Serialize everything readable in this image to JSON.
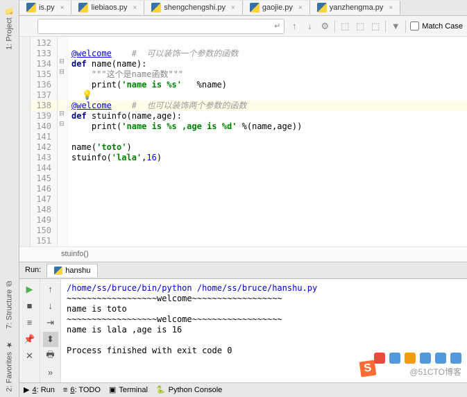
{
  "sidebar": {
    "top": [
      {
        "label": "1: Project",
        "name": "project"
      }
    ],
    "bottom": [
      {
        "label": "2: Favorites",
        "name": "favorites"
      },
      {
        "label": "7: Structure",
        "name": "structure"
      }
    ]
  },
  "tabs": [
    {
      "label": "is.py",
      "name": "is"
    },
    {
      "label": "liebiaos.py",
      "name": "liebiaos"
    },
    {
      "label": "shengchengshi.py",
      "name": "shengchengshi"
    },
    {
      "label": "gaojie.py",
      "name": "gaojie"
    },
    {
      "label": "yanzhengma.py",
      "name": "yanzhengma"
    }
  ],
  "search": {
    "placeholder": "",
    "match_case": "Match Case"
  },
  "lines": {
    "start": 132,
    "count": 20
  },
  "code": {
    "l133_dec": "@welcome",
    "l133_comment": "#  可以装饰一个参数的函数",
    "l134_def": "def ",
    "l134_name": "name(name):",
    "l135": "\"\"\"这个是name函数\"\"\"",
    "l136_print": "print(",
    "l136_str": "'name is %s'",
    "l136_end": "   %name)",
    "l138_dec": "@welcome",
    "l138_comment": "#  也可以装饰两个参数的函数",
    "l139_def": "def ",
    "l139_name": "stuinfo(name,age):",
    "l140_print": "print(",
    "l140_str": "'name is %s ,age is %d'",
    "l140_end": " %(name,age))",
    "l142": "name(",
    "l142_str": "'toto'",
    "l142_end": ")",
    "l143": "stuinfo(",
    "l143_str": "'lala'",
    "l143_num": "16",
    "l143_end": ")"
  },
  "breadcrumb": "stuinfo()",
  "run": {
    "title": "Run:",
    "tab": "hanshu",
    "output": {
      "path": "/home/ss/bruce/bin/python /home/ss/bruce/hanshu.py",
      "l1": "~~~~~~~~~~~~~~~~~~welcome~~~~~~~~~~~~~~~~~~",
      "l2": "name is toto",
      "l3": "~~~~~~~~~~~~~~~~~~welcome~~~~~~~~~~~~~~~~~~",
      "l4": "name is lala ,age is 16",
      "exit": "Process finished with exit code 0"
    }
  },
  "bottom": {
    "run": "4: Run",
    "todo": "6: TODO",
    "terminal": "Terminal",
    "console": "Python Console"
  },
  "watermark": "@51CTO博客"
}
